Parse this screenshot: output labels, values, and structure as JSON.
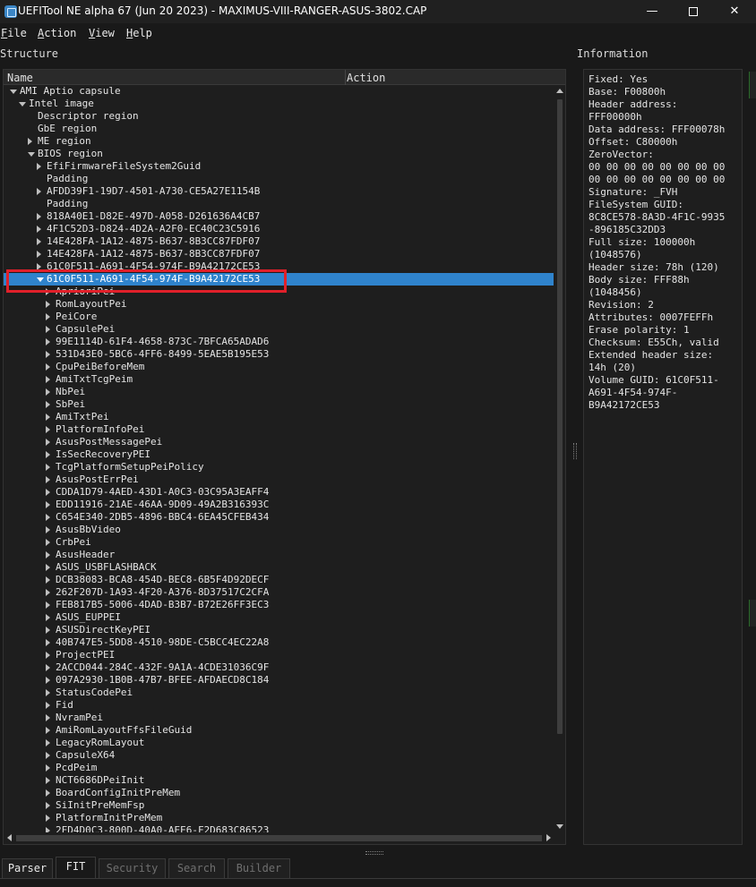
{
  "window": {
    "title": "UEFITool NE alpha 67 (Jun 20 2023) - MAXIMUS-VIII-RANGER-ASUS-3802.CAP",
    "minimize_glyph": "—",
    "close_glyph": "✕"
  },
  "menu": [
    {
      "accel": "F",
      "rest": "ile"
    },
    {
      "accel": "A",
      "rest": "ction"
    },
    {
      "accel": "V",
      "rest": "iew"
    },
    {
      "accel": "H",
      "rest": "elp"
    }
  ],
  "structure_label": "Structure",
  "information_label": "Information",
  "tree": {
    "columns": {
      "name": "Name",
      "action": "Action"
    },
    "rows": [
      {
        "label": "AMI Aptio capsule",
        "level": 0,
        "arrow": "down"
      },
      {
        "label": "Intel image",
        "level": 1,
        "arrow": "down"
      },
      {
        "label": "Descriptor region",
        "level": 2,
        "arrow": "none"
      },
      {
        "label": "GbE region",
        "level": 2,
        "arrow": "none"
      },
      {
        "label": "ME region",
        "level": 2,
        "arrow": "right"
      },
      {
        "label": "BIOS region",
        "level": 2,
        "arrow": "down"
      },
      {
        "label": "EfiFirmwareFileSystem2Guid",
        "level": 3,
        "arrow": "right"
      },
      {
        "label": "Padding",
        "level": 3,
        "arrow": "none"
      },
      {
        "label": "AFDD39F1-19D7-4501-A730-CE5A27E1154B",
        "level": 3,
        "arrow": "right"
      },
      {
        "label": "Padding",
        "level": 3,
        "arrow": "none"
      },
      {
        "label": "818A40E1-D82E-497D-A058-D261636A4CB7",
        "level": 3,
        "arrow": "right"
      },
      {
        "label": "4F1C52D3-D824-4D2A-A2F0-EC40C23C5916",
        "level": 3,
        "arrow": "right"
      },
      {
        "label": "14E428FA-1A12-4875-B637-8B3CC87FDF07",
        "level": 3,
        "arrow": "right"
      },
      {
        "label": "14E428FA-1A12-4875-B637-8B3CC87FDF07",
        "level": 3,
        "arrow": "right"
      },
      {
        "label": "61C0F511-A691-4F54-974F-B9A42172CE53",
        "level": 3,
        "arrow": "right"
      },
      {
        "label": "61C0F511-A691-4F54-974F-B9A42172CE53",
        "level": 3,
        "arrow": "down",
        "selected": true
      },
      {
        "label": "AprioriPei",
        "level": 4,
        "arrow": "right"
      },
      {
        "label": "RomLayoutPei",
        "level": 4,
        "arrow": "right"
      },
      {
        "label": "PeiCore",
        "level": 4,
        "arrow": "right"
      },
      {
        "label": "CapsulePei",
        "level": 4,
        "arrow": "right"
      },
      {
        "label": "99E1114D-61F4-4658-873C-7BFCA65ADAD6",
        "level": 4,
        "arrow": "right"
      },
      {
        "label": "531D43E0-5BC6-4FF6-8499-5EAE5B195E53",
        "level": 4,
        "arrow": "right"
      },
      {
        "label": "CpuPeiBeforeMem",
        "level": 4,
        "arrow": "right"
      },
      {
        "label": "AmiTxtTcgPeim",
        "level": 4,
        "arrow": "right"
      },
      {
        "label": "NbPei",
        "level": 4,
        "arrow": "right"
      },
      {
        "label": "SbPei",
        "level": 4,
        "arrow": "right"
      },
      {
        "label": "AmiTxtPei",
        "level": 4,
        "arrow": "right"
      },
      {
        "label": "PlatformInfoPei",
        "level": 4,
        "arrow": "right"
      },
      {
        "label": "AsusPostMessagePei",
        "level": 4,
        "arrow": "right"
      },
      {
        "label": "IsSecRecoveryPEI",
        "level": 4,
        "arrow": "right"
      },
      {
        "label": "TcgPlatformSetupPeiPolicy",
        "level": 4,
        "arrow": "right"
      },
      {
        "label": "AsusPostErrPei",
        "level": 4,
        "arrow": "right"
      },
      {
        "label": "CDDA1D79-4AED-43D1-A0C3-03C95A3EAFF4",
        "level": 4,
        "arrow": "right"
      },
      {
        "label": "EDD11916-21AE-46AA-9D09-49A2B316393C",
        "level": 4,
        "arrow": "right"
      },
      {
        "label": "C654E340-2DB5-4896-BBC4-6EA45CFEB434",
        "level": 4,
        "arrow": "right"
      },
      {
        "label": "AsusBbVideo",
        "level": 4,
        "arrow": "right"
      },
      {
        "label": "CrbPei",
        "level": 4,
        "arrow": "right"
      },
      {
        "label": "AsusHeader",
        "level": 4,
        "arrow": "right"
      },
      {
        "label": "ASUS_USBFLASHBACK",
        "level": 4,
        "arrow": "right"
      },
      {
        "label": "DCB38083-BCA8-454D-BEC8-6B5F4D92DECF",
        "level": 4,
        "arrow": "right"
      },
      {
        "label": "262F207D-1A93-4F20-A376-8D37517C2CFA",
        "level": 4,
        "arrow": "right"
      },
      {
        "label": "FEB817B5-5006-4DAD-B3B7-B72E26FF3EC3",
        "level": 4,
        "arrow": "right"
      },
      {
        "label": "ASUS_EUPPEI",
        "level": 4,
        "arrow": "right"
      },
      {
        "label": "ASUSDirectKeyPEI",
        "level": 4,
        "arrow": "right"
      },
      {
        "label": "40B747E5-5DD8-4510-98DE-C5BCC4EC22A8",
        "level": 4,
        "arrow": "right"
      },
      {
        "label": "ProjectPEI",
        "level": 4,
        "arrow": "right"
      },
      {
        "label": "2ACCD044-284C-432F-9A1A-4CDE31036C9F",
        "level": 4,
        "arrow": "right"
      },
      {
        "label": "097A2930-1B0B-47B7-BFEE-AFDAECD8C184",
        "level": 4,
        "arrow": "right"
      },
      {
        "label": "StatusCodePei",
        "level": 4,
        "arrow": "right"
      },
      {
        "label": "Fid",
        "level": 4,
        "arrow": "right"
      },
      {
        "label": "NvramPei",
        "level": 4,
        "arrow": "right"
      },
      {
        "label": "AmiRomLayoutFfsFileGuid",
        "level": 4,
        "arrow": "right"
      },
      {
        "label": "LegacyRomLayout",
        "level": 4,
        "arrow": "right"
      },
      {
        "label": "CapsuleX64",
        "level": 4,
        "arrow": "right"
      },
      {
        "label": "PcdPeim",
        "level": 4,
        "arrow": "right"
      },
      {
        "label": "NCT6686DPeiInit",
        "level": 4,
        "arrow": "right"
      },
      {
        "label": "BoardConfigInitPreMem",
        "level": 4,
        "arrow": "right"
      },
      {
        "label": "SiInitPreMemFsp",
        "level": 4,
        "arrow": "right"
      },
      {
        "label": "PlatformInitPreMem",
        "level": 4,
        "arrow": "right"
      },
      {
        "label": "2FD4D0C3-800D-40A0-AEE6-F2D683C86523",
        "level": 4,
        "arrow": "right"
      }
    ]
  },
  "information": [
    "Fixed: Yes",
    "Base: F00800h",
    "Header address:",
    "FFF00000h",
    "Data address: FFF00078h",
    "Offset: C80000h",
    "ZeroVector:",
    "00 00 00 00 00 00 00 00",
    "00 00 00 00 00 00 00 00",
    "Signature: _FVH",
    "FileSystem GUID:",
    "8C8CE578-8A3D-4F1C-9935",
    "-896185C32DD3",
    "Full size: 100000h",
    "(1048576)",
    "Header size: 78h (120)",
    "Body size: FFF88h",
    "(1048456)",
    "Revision: 2",
    "Attributes: 0007FEFFh",
    "Erase polarity: 1",
    "Checksum: E55Ch, valid",
    "Extended header size:",
    "14h (20)",
    "Volume GUID: 61C0F511-",
    "A691-4F54-974F-",
    "B9A42172CE53"
  ],
  "bottom_tabs": [
    {
      "label": "Parser",
      "state": "normal"
    },
    {
      "label": "FIT",
      "state": "active"
    },
    {
      "label": "Security",
      "state": "disabled"
    },
    {
      "label": "Search",
      "state": "disabled"
    },
    {
      "label": "Builder",
      "state": "disabled"
    }
  ],
  "colors": {
    "selection": "#2f83cc",
    "highlight_box": "#e0202a",
    "background": "#191919"
  }
}
